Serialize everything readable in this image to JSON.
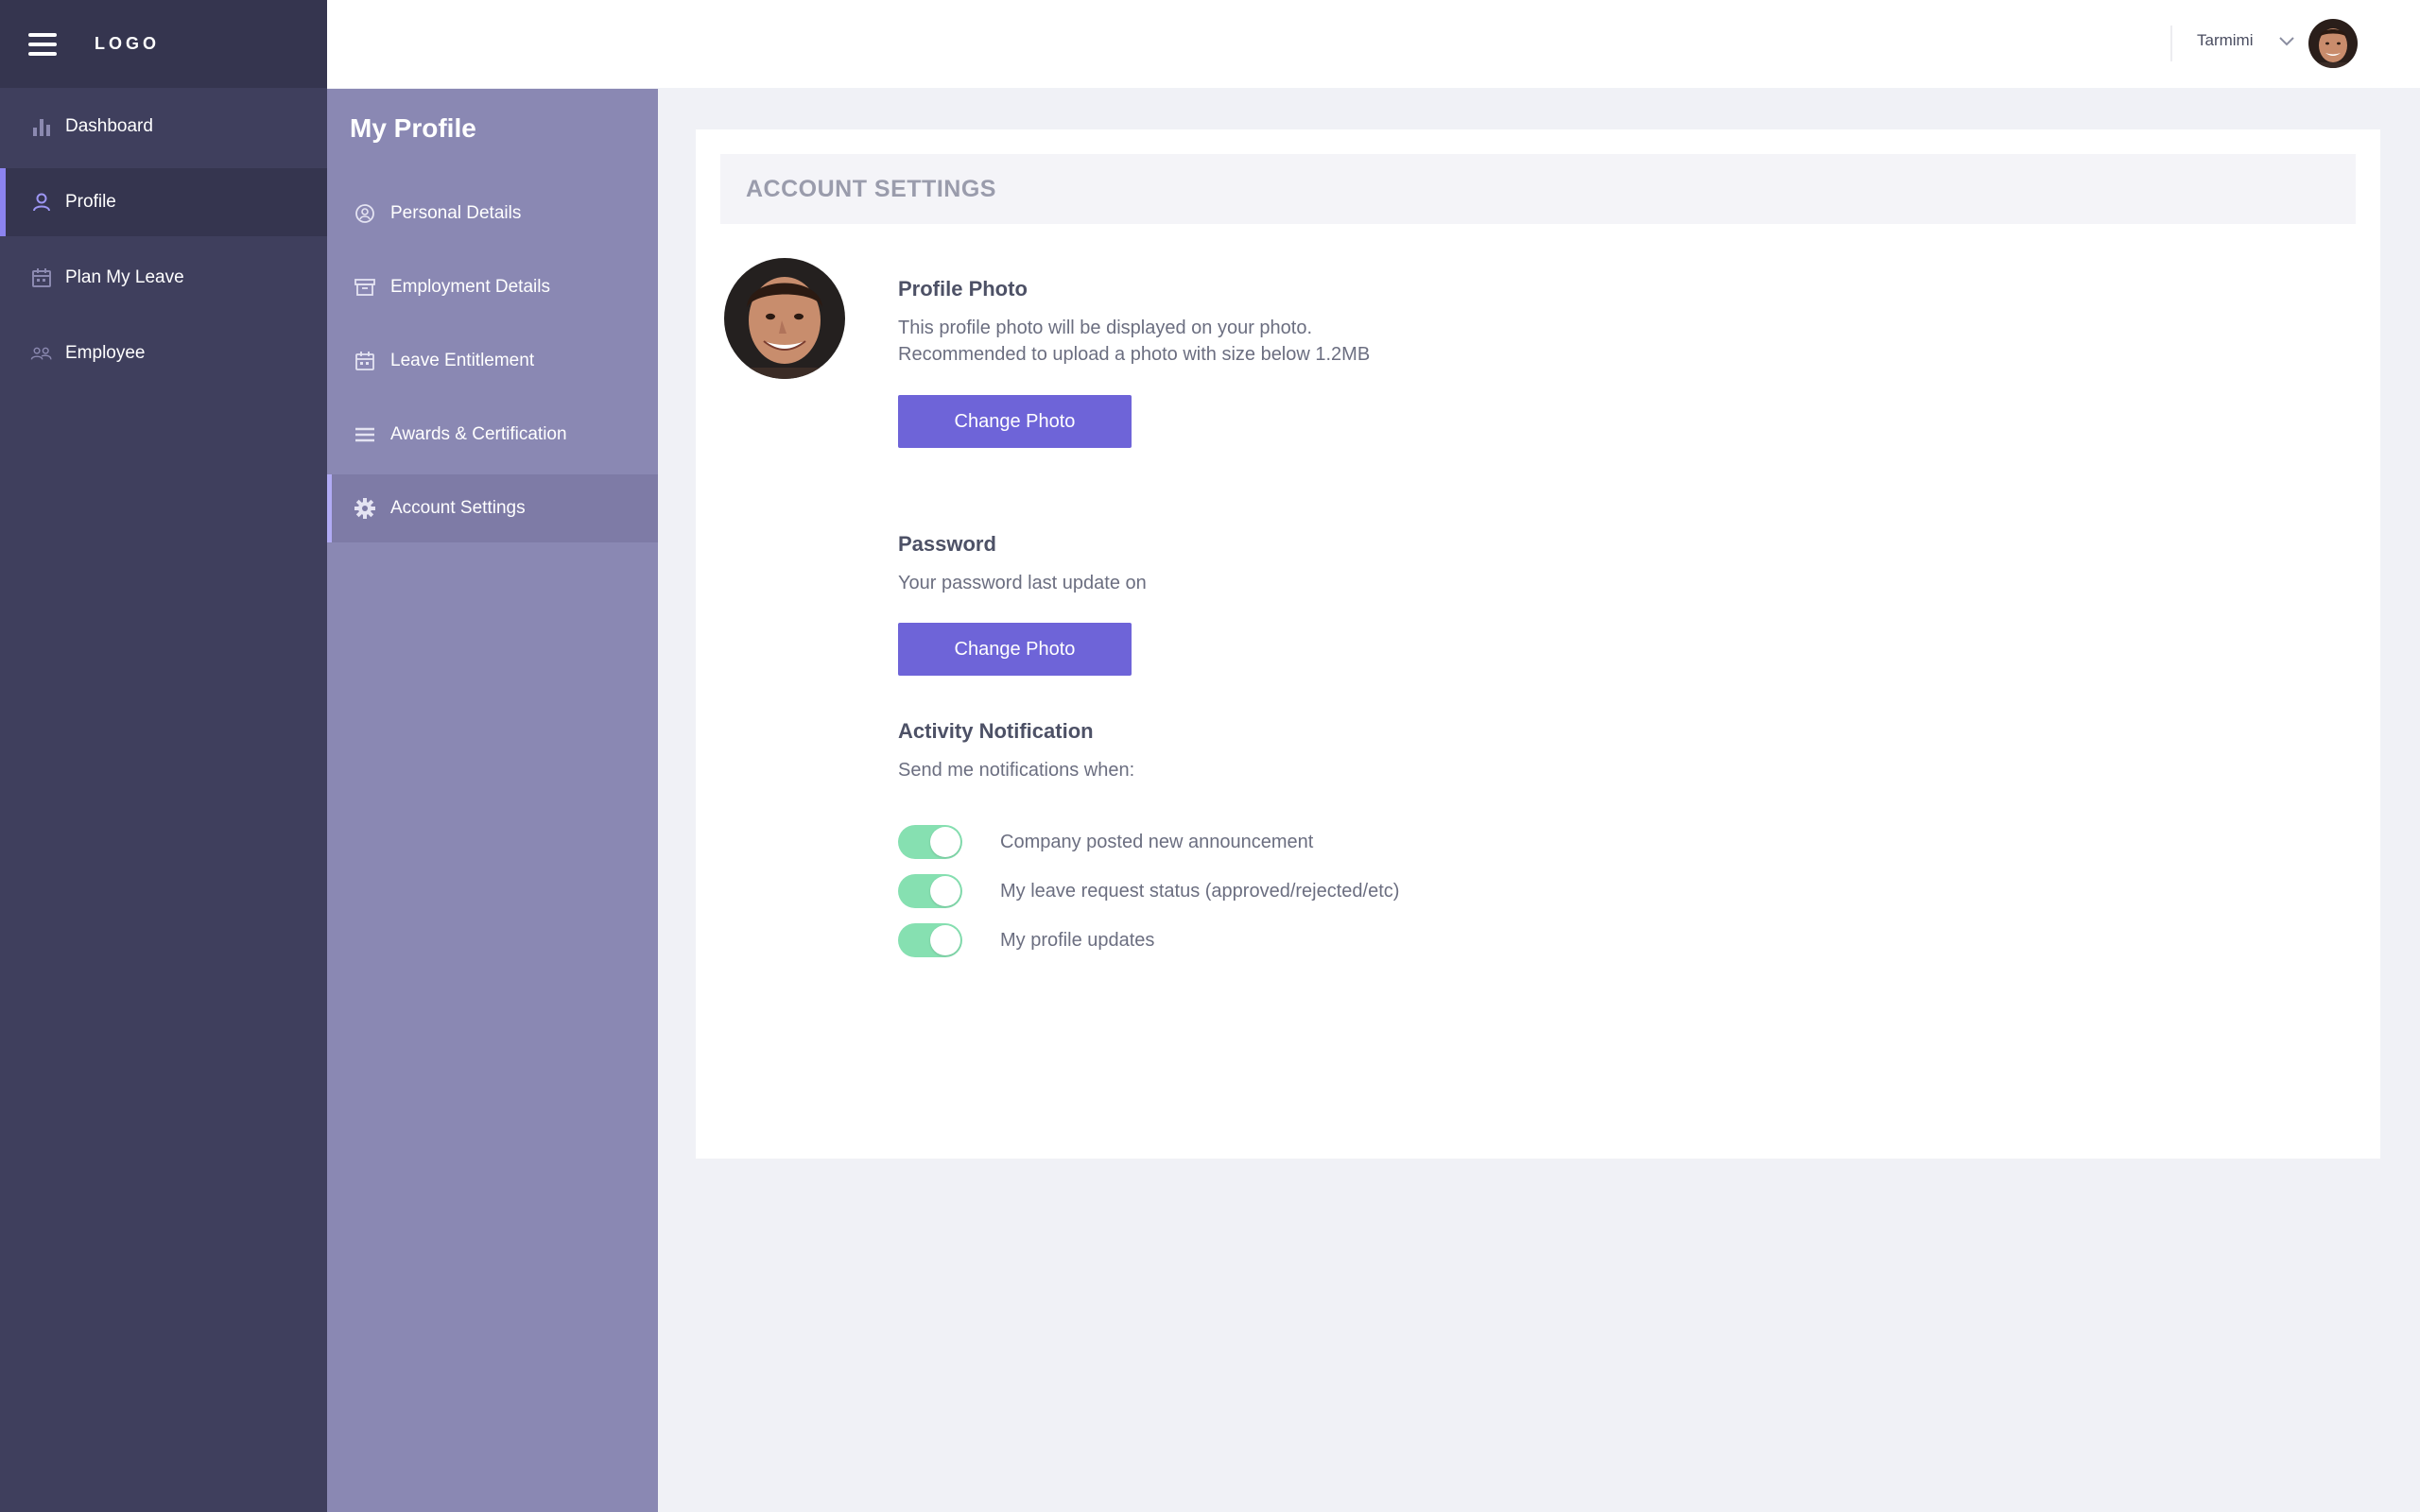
{
  "app": {
    "logo_text": "LOGO",
    "menu_icon": "hamburger-menu-icon"
  },
  "sidebar": {
    "items": [
      {
        "label": "Dashboard",
        "icon": "bar-chart-icon",
        "active": false
      },
      {
        "label": "Profile",
        "icon": "user-icon",
        "active": true
      },
      {
        "label": "Plan My Leave",
        "icon": "calendar-icon",
        "active": false
      },
      {
        "label": "Employee",
        "icon": "users-icon",
        "active": false
      }
    ]
  },
  "subnav": {
    "title": "My Profile",
    "items": [
      {
        "label": "Personal Details",
        "icon": "user-circle-icon",
        "active": false
      },
      {
        "label": "Employment Details",
        "icon": "archive-box-icon",
        "active": false
      },
      {
        "label": "Leave Entitlement",
        "icon": "calendar-icon",
        "active": false
      },
      {
        "label": "Awards & Certification",
        "icon": "list-lines-icon",
        "active": false
      },
      {
        "label": "Account Settings",
        "icon": "gear-icon",
        "active": true
      }
    ]
  },
  "header": {
    "user_name": "Tarmimi",
    "chevron_icon": "chevron-down-icon"
  },
  "main": {
    "card_title": "ACCOUNT SETTINGS",
    "profile_photo": {
      "title": "Profile Photo",
      "line1": "This profile photo will be displayed on your photo.",
      "line2": "Recommended to upload a photo with size below 1.2MB",
      "button_label": "Change Photo"
    },
    "password": {
      "title": "Password",
      "text": "Your password last update on",
      "button_label": "Change Photo"
    },
    "notifications": {
      "title": "Activity Notification",
      "subtitle": "Send me notifications when:",
      "items": [
        {
          "label": "Company posted new announcement",
          "enabled": true
        },
        {
          "label": "My leave request status (approved/rejected/etc)",
          "enabled": true
        },
        {
          "label": "My profile updates",
          "enabled": true
        }
      ]
    }
  },
  "colors": {
    "sidebar_bg": "#3f3f5d",
    "subnav_bg": "#8a88b3",
    "accent": "#6e64d8",
    "toggle_on": "#86e0b1",
    "page_bg": "#f0f1f6"
  }
}
